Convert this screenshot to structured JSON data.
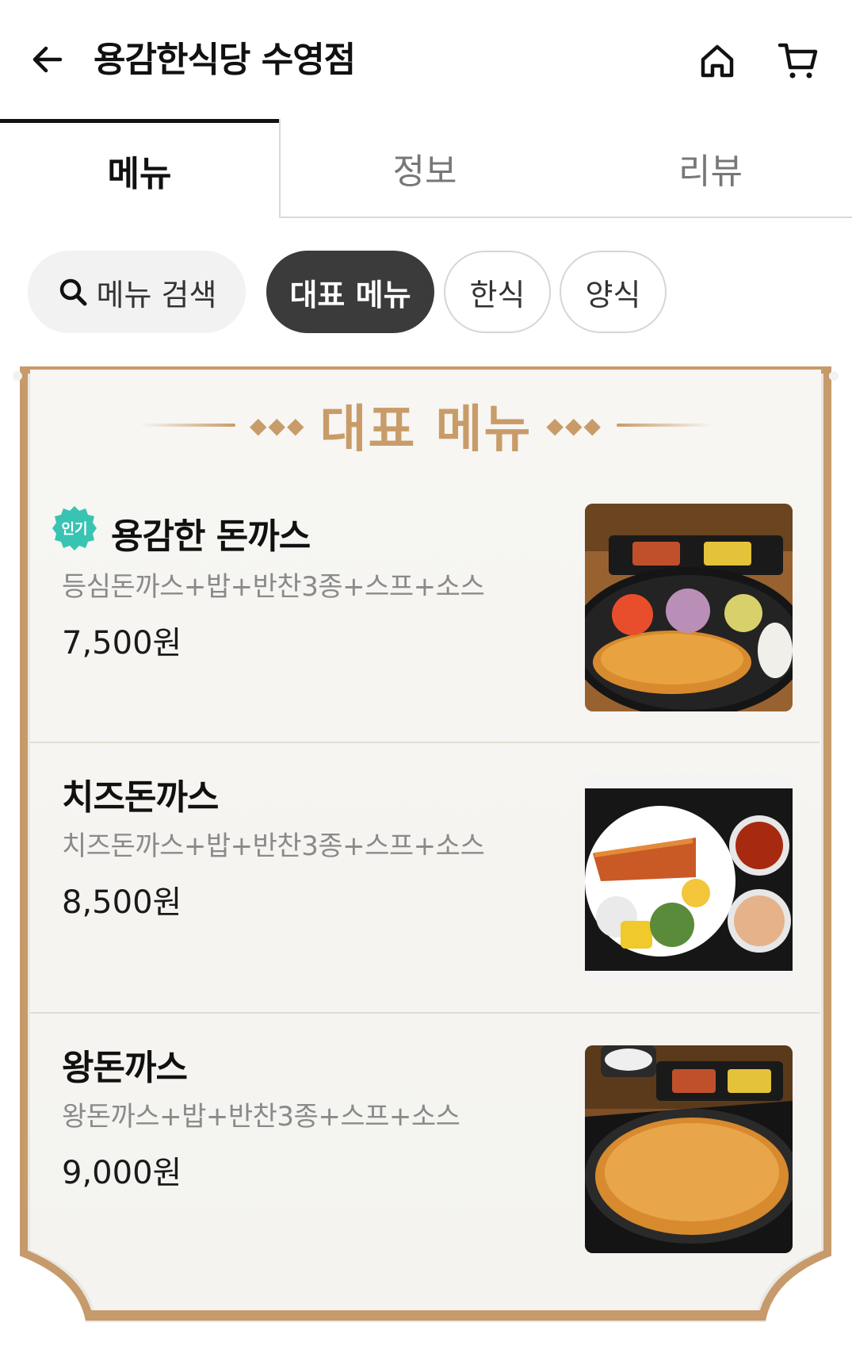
{
  "header": {
    "title": "용감한식당 수영점"
  },
  "tabs": [
    {
      "label": "메뉴",
      "active": true
    },
    {
      "label": "정보",
      "active": false
    },
    {
      "label": "리뷰",
      "active": false
    }
  ],
  "chips": {
    "search_label": "메뉴 검색",
    "items": [
      {
        "label": "대표 메뉴",
        "selected": true
      },
      {
        "label": "한식",
        "selected": false
      },
      {
        "label": "양식",
        "selected": false
      }
    ]
  },
  "section": {
    "title": "대표 메뉴"
  },
  "menu_items": [
    {
      "badge": "인기",
      "name": "용감한 돈까스",
      "description": "등심돈까스+밥+반찬3종+스프+소스",
      "price": "7,500원"
    },
    {
      "name": "치즈돈까스",
      "description": "치즈돈까스+밥+반찬3종+스프+소스",
      "price": "8,500원"
    },
    {
      "name": "왕돈까스",
      "description": "왕돈까스+밥+반찬3종+스프+소스",
      "price": "9,000원"
    }
  ],
  "colors": {
    "accent_gold": "#c89c69",
    "badge_teal": "#39c3b3",
    "chip_selected": "#3b3b3b"
  }
}
